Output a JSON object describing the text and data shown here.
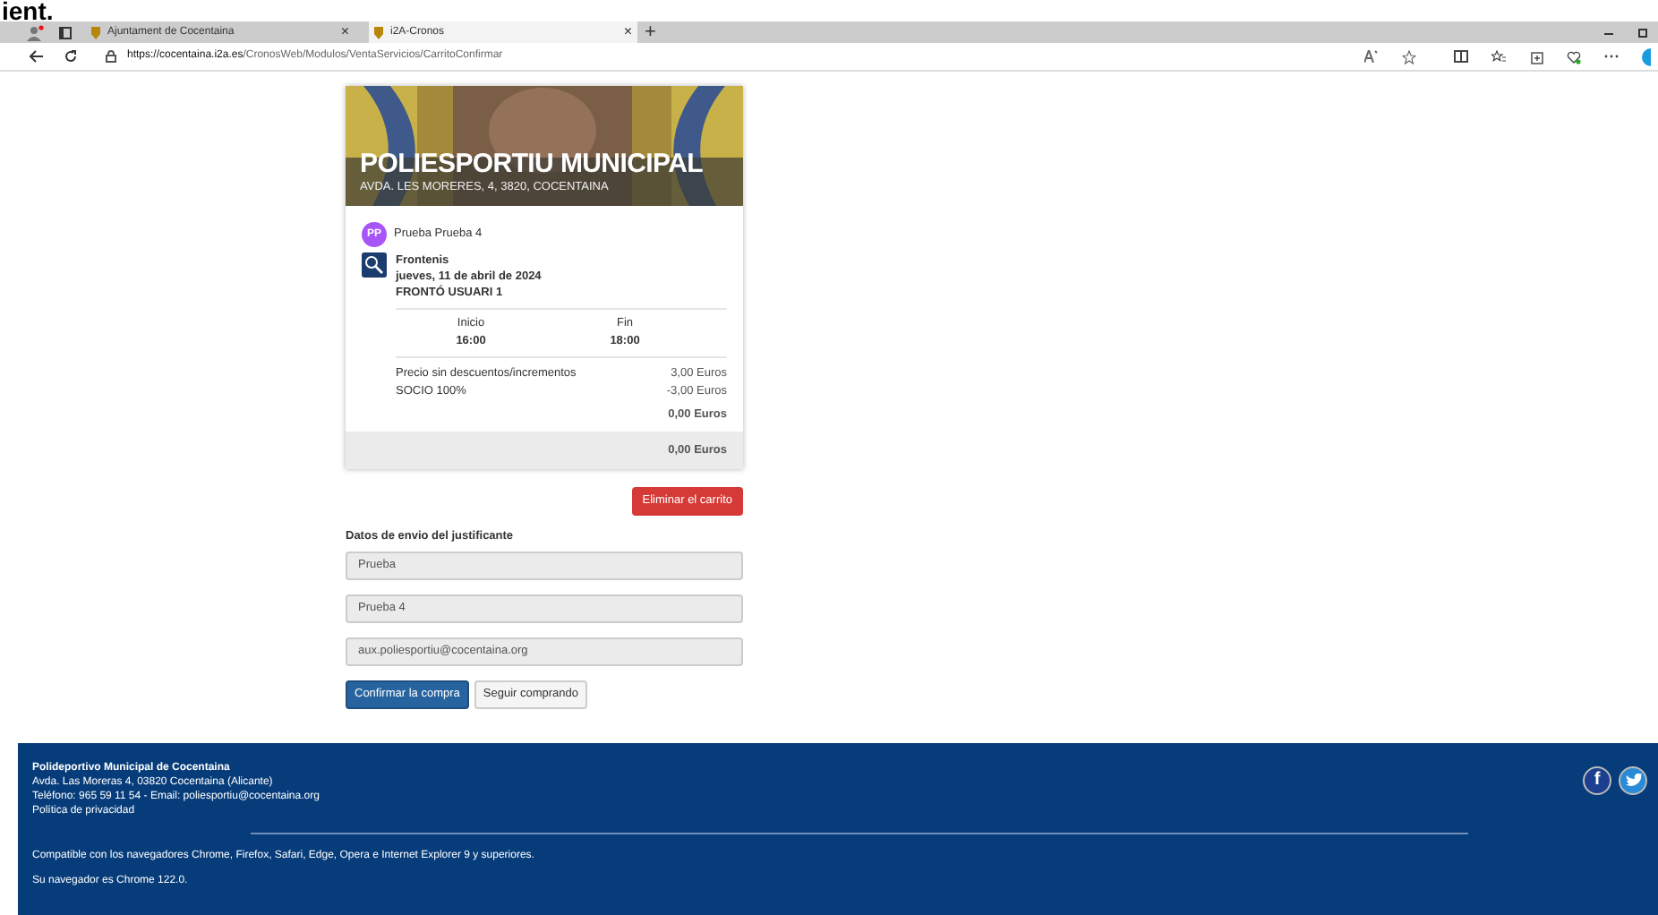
{
  "top_caption": "ient.",
  "browser": {
    "tabs": [
      {
        "title": "Ajuntament de Cocentaina",
        "selected": false,
        "close": "×"
      },
      {
        "title": "i2A-Cronos",
        "selected": true,
        "close": "×"
      }
    ],
    "new_tab": "+",
    "url_host": "https://cocentaina.i2a.es",
    "url_path": "/CronosWeb/Modulos/VentaServicios/CarritoConfirmar"
  },
  "venue": {
    "kind": "picture",
    "name": "POLIESPORTIU MUNICIPAL",
    "address": "AVDA. LES MORERES, 4, 3820, COCENTAINA"
  },
  "user": {
    "initials": "PP",
    "name": "Prueba Prueba 4",
    "color": "#a855f7"
  },
  "booking": {
    "activity": "Frontenis",
    "date": "jueves, 11 de abril de 2024",
    "court": "FRONTÓ USUARI 1",
    "start_label": "Inicio",
    "start": "16:00",
    "end_label": "Fin",
    "end": "18:00"
  },
  "price_lines": [
    {
      "label": "Precio sin descuentos/incrementos",
      "amount": "3,00 Euros"
    },
    {
      "label": "SOCIO 100%",
      "amount": "-3,00 Euros"
    }
  ],
  "subtotal": "0,00 Euros",
  "total": "0,00 Euros",
  "remove_button": "Eliminar el carrito",
  "form": {
    "title": "Datos de envio del justificante",
    "fields": [
      {
        "value": "Prueba"
      },
      {
        "value": "Prueba 4"
      },
      {
        "value": "aux.poliesportiu@cocentaina.org"
      }
    ]
  },
  "buttons": [
    {
      "label": "Confirmar la compra",
      "kind": "primary"
    },
    {
      "label": "Seguir comprando",
      "kind": "default"
    }
  ],
  "footer": {
    "title": "Polideportivo Municipal de Cocentaina",
    "lines": [
      "Avda. Las Moreras 4, 03820 Cocentaina (Alicante)",
      "Teléfono: 965 59 11 54 - Email: poliesportiu@cocentaina.org"
    ],
    "privacy_link": "Política de privacidad",
    "compat": "Compatible con los navegadores Chrome, Firefox, Safari, Edge, Opera e Internet Explorer 9 y superiores.",
    "browser_note": "Su navegador es Chrome 122.0.",
    "social": [
      {
        "kind": "facebook",
        "glyph": "f"
      },
      {
        "kind": "twitter"
      }
    ]
  }
}
